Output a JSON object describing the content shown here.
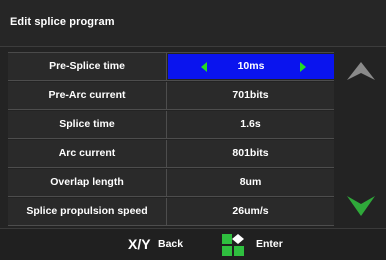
{
  "window": {
    "title": "Edit splice program"
  },
  "parameters": [
    {
      "label": "Pre-Splice time",
      "value": "10ms",
      "selected": true
    },
    {
      "label": "Pre-Arc current",
      "value": "701bits",
      "selected": false
    },
    {
      "label": "Splice time",
      "value": "1.6s",
      "selected": false
    },
    {
      "label": "Arc current",
      "value": "801bits",
      "selected": false
    },
    {
      "label": "Overlap length",
      "value": "8um",
      "selected": false
    },
    {
      "label": "Splice propulsion speed",
      "value": "26um/s",
      "selected": false
    }
  ],
  "side_panel": {
    "up_icon": "chevron-up-icon",
    "down_icon": "chevron-down-icon"
  },
  "footer": {
    "back_key_x": "X",
    "back_key_sep": "/",
    "back_key_y": "Y",
    "back_label": "Back",
    "enter_icon": "keypad-enter-icon",
    "enter_label": "Enter"
  },
  "colors": {
    "background": "#232323",
    "selected_value": "#0a14ee",
    "value_arrows": "#22dd22",
    "scroll_up_arrow": "#8a8a8a",
    "scroll_down_arrow": "#2fa93a",
    "enter_icon_green": "#2fbf3f",
    "text": "#ffffff"
  }
}
